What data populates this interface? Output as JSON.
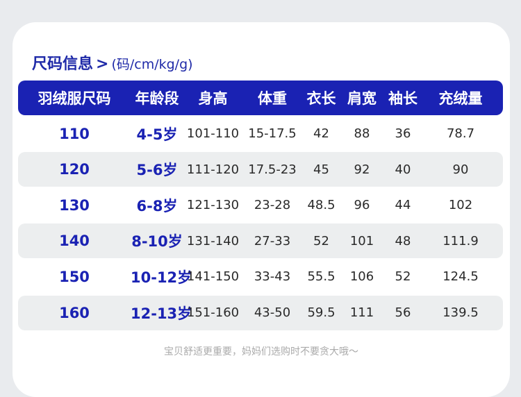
{
  "heading": {
    "title": "尺码信息",
    "chevron": ">",
    "units": "(码/cm/kg/g)"
  },
  "table": {
    "columns": [
      "羽绒服尺码",
      "年龄段",
      "身高",
      "体重",
      "衣长",
      "肩宽",
      "袖长",
      "充绒量"
    ],
    "rows": [
      [
        "110",
        "4-5岁",
        "101-110",
        "15-17.5",
        "42",
        "88",
        "36",
        "78.7"
      ],
      [
        "120",
        "5-6岁",
        "111-120",
        "17.5-23",
        "45",
        "92",
        "40",
        "90"
      ],
      [
        "130",
        "6-8岁",
        "121-130",
        "23-28",
        "48.5",
        "96",
        "44",
        "102"
      ],
      [
        "140",
        "8-10岁",
        "131-140",
        "27-33",
        "52",
        "101",
        "48",
        "111.9"
      ],
      [
        "150",
        "10-12岁",
        "141-150",
        "33-43",
        "55.5",
        "106",
        "52",
        "124.5"
      ],
      [
        "160",
        "12-13岁",
        "151-160",
        "43-50",
        "59.5",
        "111",
        "56",
        "139.5"
      ]
    ]
  },
  "footer": {
    "note": "宝贝舒适更重要，妈妈们选购时不要贪大哦～"
  },
  "colors": {
    "accent": "#1a22b3",
    "row_alt": "#eceeef",
    "background": "#e9ebee"
  }
}
